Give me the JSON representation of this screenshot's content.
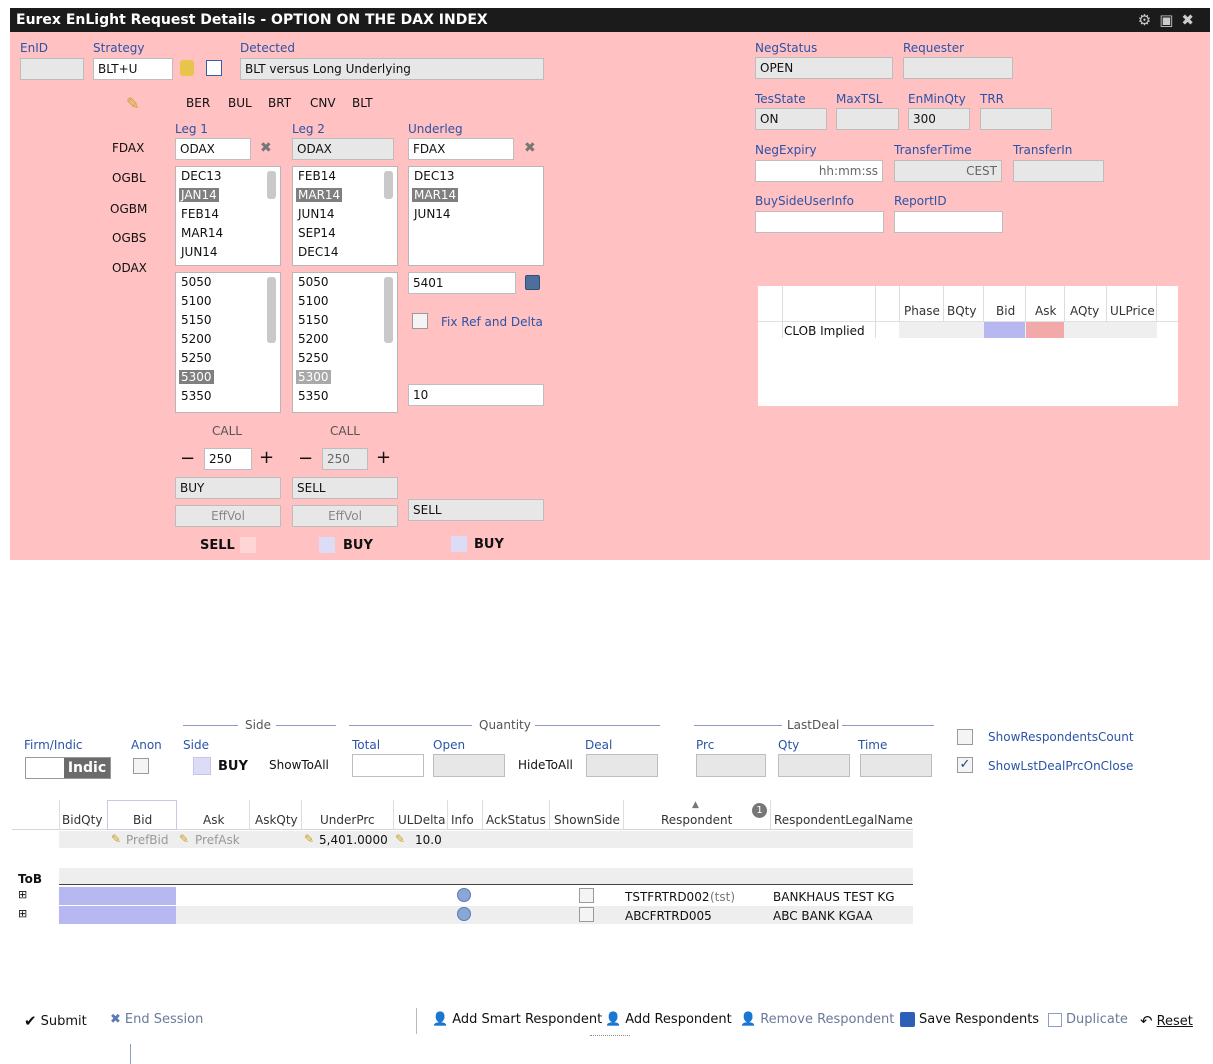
{
  "window": {
    "title": "Eurex EnLight Request Details - OPTION ON THE DAX INDEX"
  },
  "header": {
    "enid_label": "EnID",
    "enid_value": "",
    "strategy_label": "Strategy",
    "strategy_value": "BLT+U",
    "detected_label": "Detected",
    "detected_value": "BLT versus Long Underlying",
    "strategy_tabs": [
      "BER",
      "BUL",
      "BRT",
      "CNV",
      "BLT"
    ]
  },
  "products": [
    "FDAX",
    "OGBL",
    "OGBM",
    "OGBS",
    "ODAX"
  ],
  "legs": {
    "leg1": {
      "label": "Leg 1",
      "product": "ODAX",
      "expiries": [
        "DEC13",
        "JAN14",
        "FEB14",
        "MAR14",
        "JUN14"
      ],
      "strikes": [
        "5050",
        "5100",
        "5150",
        "5200",
        "5250",
        "5300",
        "5350"
      ],
      "type": "CALL",
      "qty": "250",
      "side": "BUY",
      "effvol": "EffVol",
      "bottom_side": "SELL"
    },
    "leg2": {
      "label": "Leg 2",
      "product": "ODAX",
      "expiries": [
        "FEB14",
        "MAR14",
        "JUN14",
        "SEP14",
        "DEC14"
      ],
      "strikes": [
        "5050",
        "5100",
        "5150",
        "5200",
        "5250",
        "5300",
        "5350"
      ],
      "type": "CALL",
      "qty": "250",
      "side": "SELL",
      "effvol": "EffVol",
      "bottom_side": "BUY"
    },
    "underleg": {
      "label": "Underleg",
      "product": "FDAX",
      "expiries": [
        "DEC13",
        "MAR14",
        "JUN14"
      ],
      "price": "5401",
      "fix_ref": "Fix Ref and Delta",
      "delta": "10",
      "side": "SELL",
      "bottom_side": "BUY"
    }
  },
  "right": {
    "negstatus_label": "NegStatus",
    "negstatus_value": "OPEN",
    "requester_label": "Requester",
    "requester_value": "",
    "tesstate_label": "TesState",
    "tesstate_value": "ON",
    "maxtsl_label": "MaxTSL",
    "maxtsl_value": "",
    "enminqty_label": "EnMinQty",
    "enminqty_value": "300",
    "trr_label": "TRR",
    "trr_value": "",
    "negexpiry_label": "NegExpiry",
    "negexpiry_value": "hh:mm:ss",
    "transfertime_label": "TransferTime",
    "transfertime_value": "CEST",
    "transferin_label": "TransferIn",
    "transferin_value": "",
    "buysideuserinfo_label": "BuySideUserInfo",
    "buysideuserinfo_value": "",
    "reportid_label": "ReportID",
    "reportid_value": ""
  },
  "clob": {
    "headers": [
      "",
      "",
      "Phase",
      "BQty",
      "Bid",
      "Ask",
      "AQty",
      "ULPrice"
    ],
    "row_label": "CLOB Implied",
    "bid_color": "#b7b7f2",
    "ask_color": "#f2a9a9"
  },
  "order": {
    "side_group": "Side",
    "quantity_group": "Quantity",
    "lastdeal_group": "LastDeal",
    "firm_indic_label": "Firm/Indic",
    "firm_indic_value": "Indic",
    "anon_label": "Anon",
    "side_label": "Side",
    "side_value": "BUY",
    "show_to_all": "ShowToAll",
    "total_label": "Total",
    "open_label": "Open",
    "hide_to_all": "HideToAll",
    "deal_label": "Deal",
    "prc_label": "Prc",
    "qty_label": "Qty",
    "time_label": "Time",
    "show_resp_count": "ShowRespondentsCount",
    "show_lst_deal": "ShowLstDealPrcOnClose"
  },
  "grid": {
    "headers": [
      "BidQty",
      "Bid",
      "Ask",
      "AskQty",
      "UnderPrc",
      "ULDelta",
      "Info",
      "AckStatus",
      "ShownSide",
      "Respondent",
      "RespondentLegalName"
    ],
    "badge": "1",
    "pref_bid": "PrefBid",
    "pref_ask": "PrefAsk",
    "under_prc": "5,401.0000",
    "ul_delta": "10.0",
    "tob_label": "ToB",
    "rows": [
      {
        "respondent": "TSTFRTRD002",
        "tag": "(tst)",
        "legal": "BANKHAUS TEST KG"
      },
      {
        "respondent": "ABCFRTRD005",
        "tag": "",
        "legal": "ABC BANK KGAA"
      }
    ]
  },
  "toolbar": {
    "submit": "Submit",
    "end_session": "End Session",
    "add_smart": "Add Smart Respondent",
    "add_resp": "Add Respondent",
    "remove_resp": "Remove Respondent",
    "save_resp": "Save Respondents",
    "duplicate": "Duplicate",
    "reset": "Reset"
  },
  "colors": {
    "pink": "#ffc1c1",
    "label_blue": "#2b53a8",
    "lavender": "#b7b7f2"
  }
}
